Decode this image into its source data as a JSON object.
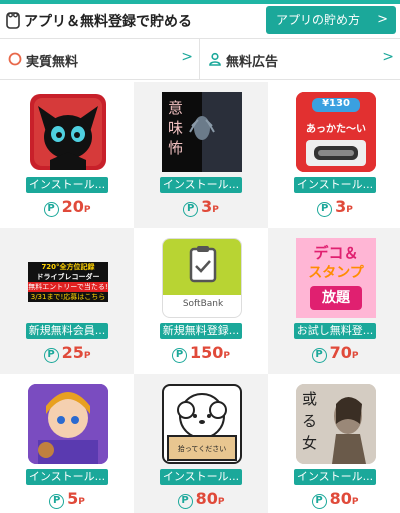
{
  "header": {
    "title": "アプリ＆無料登録で貯める",
    "howto_label": "アプリの貯め方",
    "howto_chevron": ">"
  },
  "tabs": [
    {
      "label": "実質無料",
      "chevron": ">",
      "icon": "circle-icon",
      "color": "#e8684a"
    },
    {
      "label": "無料広告",
      "chevron": ">",
      "icon": "person-icon",
      "color": "#1ba89a"
    }
  ],
  "point_symbol": "P",
  "point_unit": "P",
  "items": [
    {
      "label": "インストール...",
      "points": "20"
    },
    {
      "label": "インストール...",
      "points": "3"
    },
    {
      "label": "インストール...",
      "points": "3"
    },
    {
      "label": "新規無料会員...",
      "points": "25"
    },
    {
      "label": "新規無料登録...",
      "points": "150"
    },
    {
      "label": "お試し無料登...",
      "points": "70"
    },
    {
      "label": "インストール...",
      "points": "5"
    },
    {
      "label": "インストール...",
      "points": "80"
    },
    {
      "label": "インストール...",
      "points": "80"
    }
  ],
  "art_text": {
    "horror": [
      "意",
      "味",
      "怖"
    ],
    "price": "¥130",
    "akkata": "あっかた～い",
    "recorder_line1": "720°全方位記録",
    "recorder_line2": "ドライブレコーダー",
    "recorder_line3": "無料エントリーで当たる!",
    "recorder_line4": "3/31まで!応募はこちら",
    "softbank": "SoftBank",
    "deco1": "デコ＆",
    "deco2": "スタンプ",
    "deco3": "放題",
    "dog_sign": "拾ってください",
    "wakuonna": [
      "或",
      "る",
      "女"
    ]
  },
  "colors": {
    "accent": "#1ba89a",
    "points": "#e04a3a",
    "shade": "#f2f2f2"
  }
}
